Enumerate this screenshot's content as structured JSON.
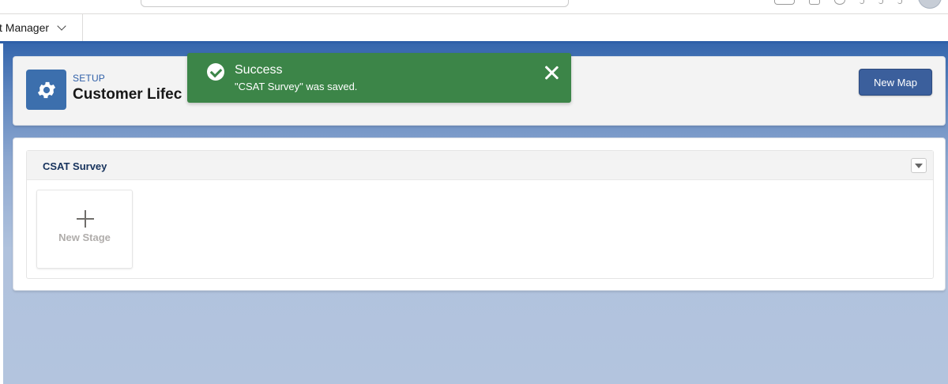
{
  "nav": {
    "app_label": "ct Manager"
  },
  "page_header": {
    "eyebrow": "SETUP",
    "title": "Customer Lifec",
    "new_map_label": "New Map"
  },
  "section": {
    "title": "CSAT Survey",
    "new_stage_label": "New Stage"
  },
  "toast": {
    "title": "Success",
    "message": "\"CSAT Survey\" was saved.",
    "color": "#3c8548"
  },
  "colors": {
    "brand": "#2e5fa8",
    "button": "#3b5f9c",
    "section_title": "#16325c"
  },
  "icons": {
    "page_header": "gear-icon",
    "toast_status": "check-circle-icon",
    "toast_close": "close-icon",
    "nav_dropdown": "chevron-down-icon",
    "section_menu": "caret-down-icon",
    "new_stage": "plus-icon"
  }
}
